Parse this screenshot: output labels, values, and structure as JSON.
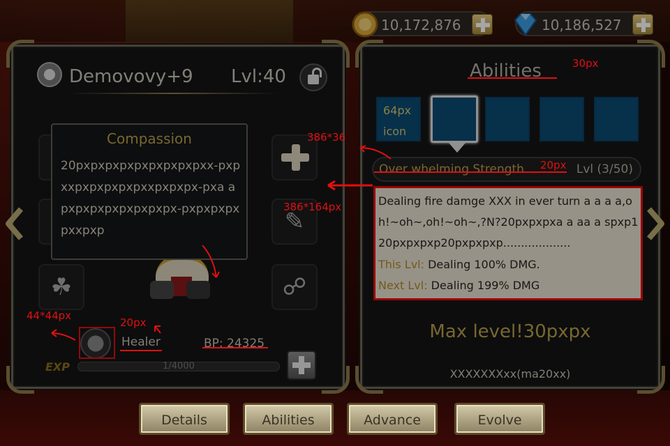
{
  "currency": {
    "gold": "10,172,876",
    "gems": "10,186,527"
  },
  "hero": {
    "name": "Demovovy+9",
    "level": "Lvl:40",
    "class": "Healer",
    "bp": "BP: 24325",
    "exp_label": "EXP",
    "exp_text": "1/4000",
    "exp_fraction": 0.00025
  },
  "tooltip": {
    "title": "Compassion",
    "body": "20pxpxpxpxpxpxpxpxpxx-pxpxxpxpxpxpxpxxpxpxpx-pxa a pxpxpxpxpxpxpxpx-pxpxpxpxpxxpxp"
  },
  "abilities": {
    "title": "Abilities",
    "tab1_line1": "64px",
    "tab1_line2": "icon",
    "skill_name": "Over whelming Strength",
    "skill_level": "Lvl (3/50)",
    "description": "Dealing fire damge XXX in ever turn a  a a a,oh!~oh~,oh!~oh~,?N?20pxpxpxa a aa a spxp120pxpxpxp20pxpxpxp...................",
    "this_lvl_label": "This Lvl:",
    "this_lvl_value": " Dealing 100% DMG.",
    "next_lvl_label": "Next Lvl:",
    "next_lvl_value": " Dealing 199% DMG",
    "max_level": "Max level!30pxpx",
    "footer": "XXXXXXXxx(ma20xx)"
  },
  "annotations": {
    "a_30px": "30px",
    "a_386x36": "386*36",
    "a_20px_skill": "20px",
    "a_386x164": "386*164px",
    "a_44x44": "44*44px",
    "a_20px_class": "20px"
  },
  "bottom_tabs": [
    "Details",
    "Abilities",
    "Advance",
    "Evolve"
  ],
  "colors": {
    "gold_text": "#b89e4a",
    "annotation_red": "#e01010",
    "ability_tab_blue": "#0b4a74"
  }
}
